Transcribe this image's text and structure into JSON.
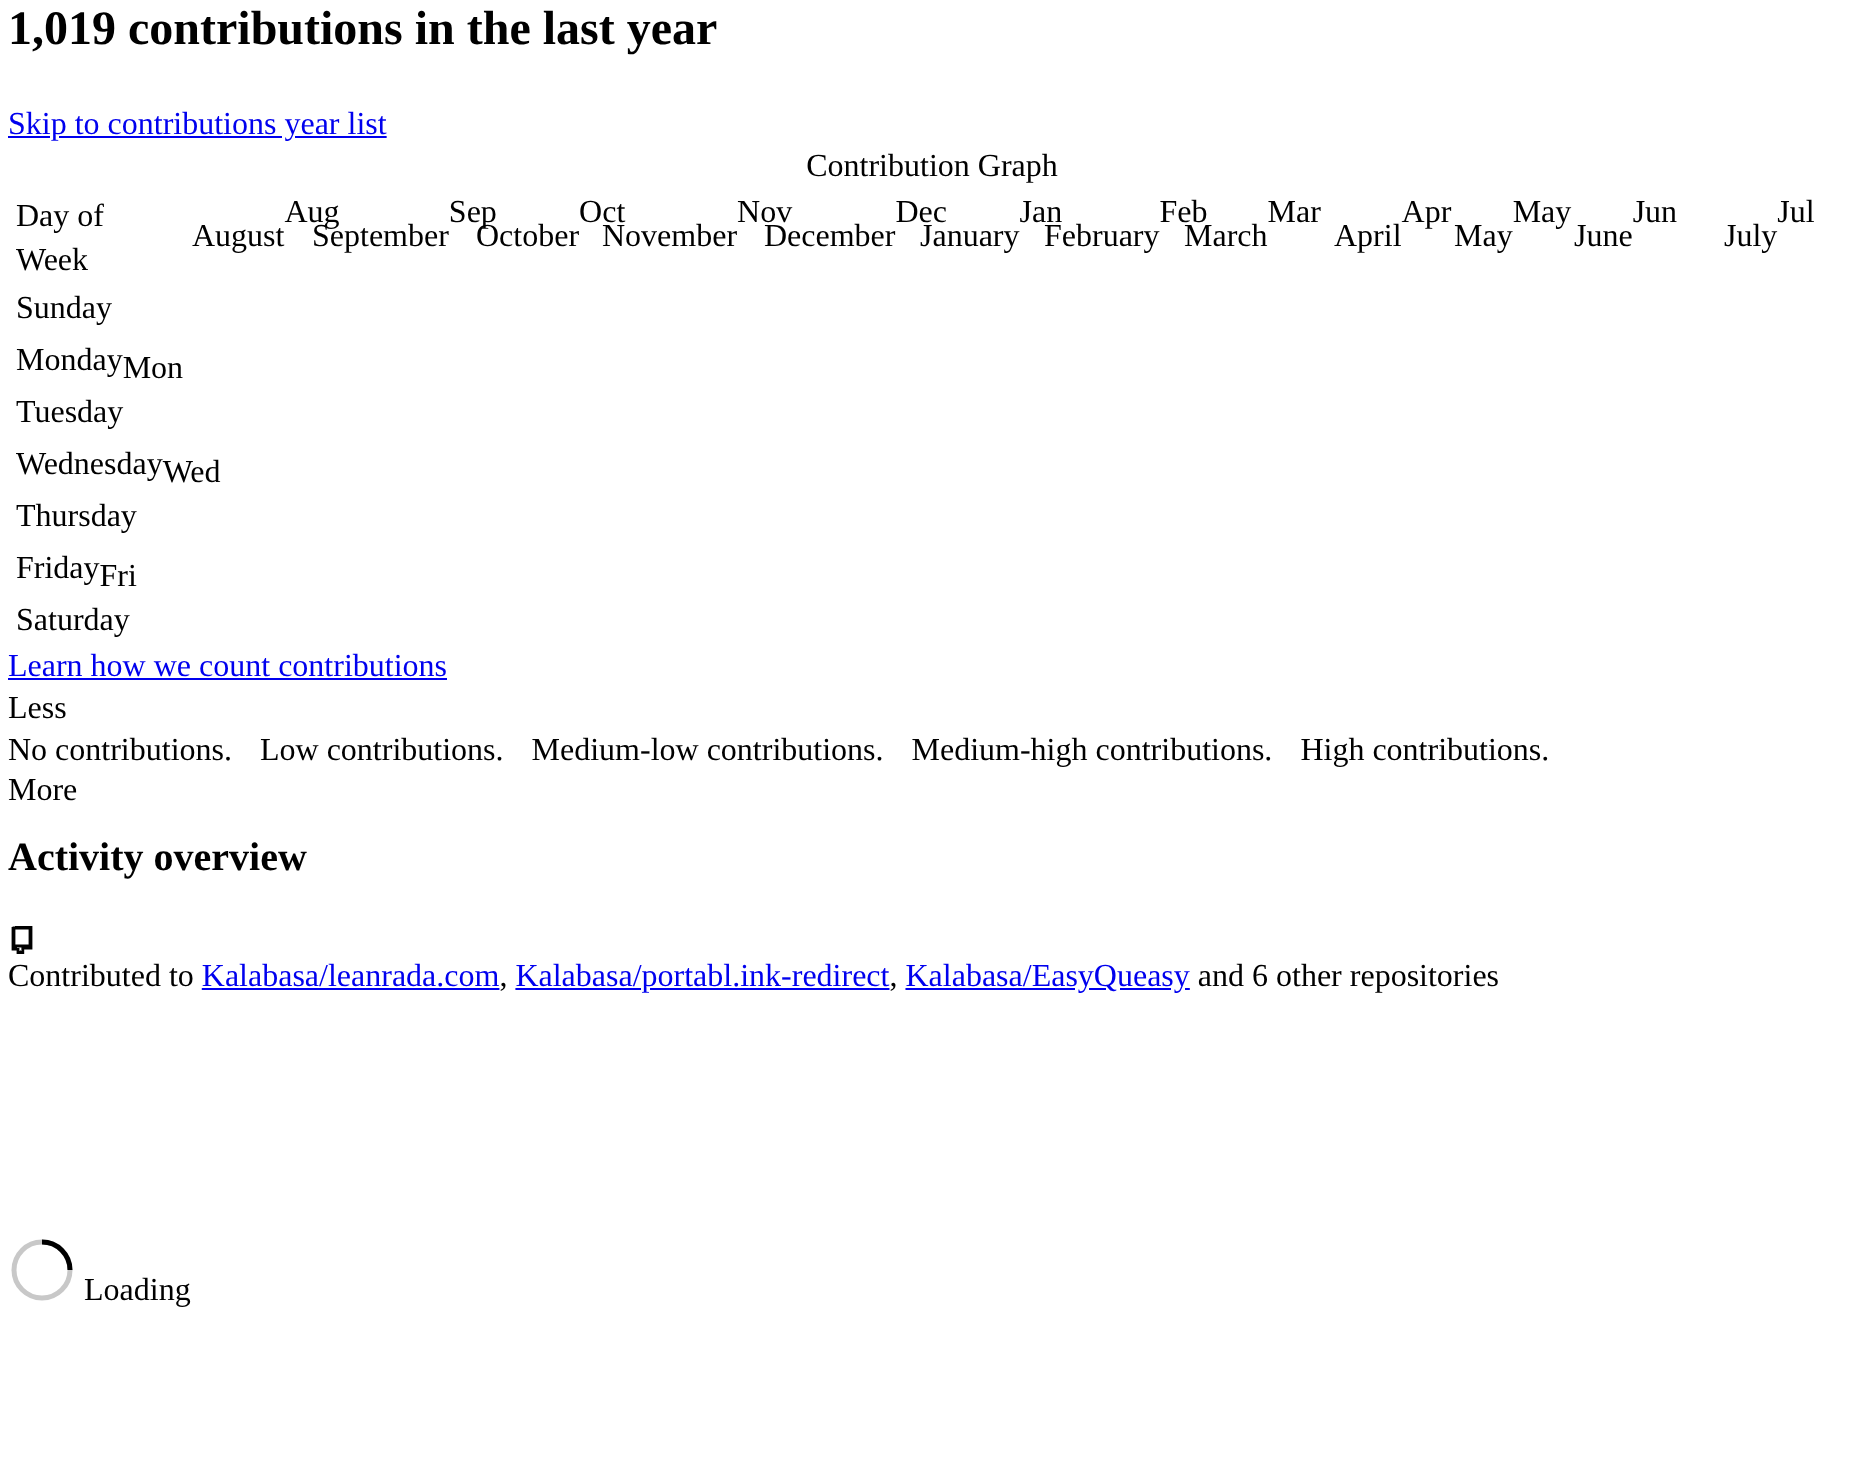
{
  "heading": "1,019 contributions in the last year",
  "skip_link": "Skip to contributions year list",
  "graph": {
    "caption": "Contribution Graph",
    "corner_header": "Day of Week",
    "months": [
      {
        "name": "August",
        "short": "Aug"
      },
      {
        "name": "September",
        "short": "Sep"
      },
      {
        "name": "October",
        "short": "Oct"
      },
      {
        "name": "November",
        "short": "Nov"
      },
      {
        "name": "December",
        "short": "Dec"
      },
      {
        "name": "January",
        "short": "Jan"
      },
      {
        "name": "February",
        "short": "Feb"
      },
      {
        "name": "March",
        "short": "Mar"
      },
      {
        "name": "April",
        "short": "Apr"
      },
      {
        "name": "May",
        "short": "May"
      },
      {
        "name": "June",
        "short": "Jun"
      },
      {
        "name": "July",
        "short": "Jul"
      }
    ],
    "days": [
      {
        "name": "Sunday"
      },
      {
        "name": "Monday",
        "short": "Mon"
      },
      {
        "name": "Tuesday"
      },
      {
        "name": "Wednesday",
        "short": "Wed"
      },
      {
        "name": "Thursday"
      },
      {
        "name": "Friday",
        "short": "Fri"
      },
      {
        "name": "Saturday"
      }
    ]
  },
  "learn_link": "Learn how we count contributions",
  "legend": {
    "less": "Less",
    "levels": [
      "No contributions.",
      "Low contributions.",
      "Medium-low contributions.",
      "Medium-high contributions.",
      "High contributions."
    ],
    "more": "More"
  },
  "activity": {
    "title": "Activity overview",
    "sentence": [
      {
        "kind": "text",
        "text": "Contributed to "
      },
      {
        "kind": "link",
        "text": "Kalabasa/leanrada.com"
      },
      {
        "kind": "text",
        "text": ", "
      },
      {
        "kind": "link",
        "text": "Kalabasa/portabl.ink-redirect"
      },
      {
        "kind": "text",
        "text": ", "
      },
      {
        "kind": "link",
        "text": "Kalabasa/EasyQueasy"
      },
      {
        "kind": "text",
        "text": " and 6 other repositories"
      }
    ]
  },
  "loading": "Loading"
}
